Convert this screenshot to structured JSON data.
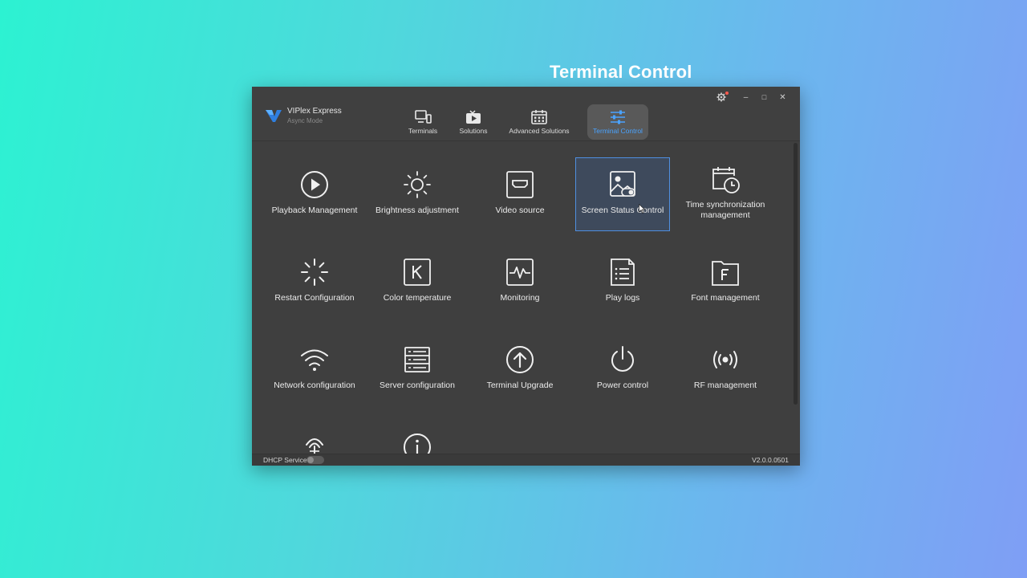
{
  "heading": "Terminal Control",
  "app": {
    "name": "VIPlex Express",
    "mode": "Async Mode"
  },
  "nav": [
    {
      "label": "Terminals",
      "icon": "terminals-icon"
    },
    {
      "label": "Solutions",
      "icon": "solutions-icon"
    },
    {
      "label": "Advanced Solutions",
      "icon": "calendar-icon"
    },
    {
      "label": "Terminal Control",
      "icon": "sliders-icon",
      "active": true
    }
  ],
  "window_controls": {
    "settings_icon": "gear-icon",
    "minimize": "–",
    "maximize": "□",
    "close": "✕"
  },
  "tiles": [
    {
      "label": "Playback Management",
      "icon": "play-circle-icon"
    },
    {
      "label": "Brightness adjustment",
      "icon": "sun-icon"
    },
    {
      "label": "Video source",
      "icon": "hdmi-icon"
    },
    {
      "label": "Screen Status Control",
      "icon": "screen-status-icon",
      "selected": true
    },
    {
      "label": "Time synchronization management",
      "icon": "calendar-clock-icon"
    },
    {
      "label": "Restart Configuration",
      "icon": "restart-spinner-icon"
    },
    {
      "label": "Color temperature",
      "icon": "k-box-icon"
    },
    {
      "label": "Monitoring",
      "icon": "pulse-monitor-icon"
    },
    {
      "label": "Play logs",
      "icon": "log-document-icon"
    },
    {
      "label": "Font management",
      "icon": "font-folder-icon"
    },
    {
      "label": "Network configuration",
      "icon": "wifi-icon"
    },
    {
      "label": "Server configuration",
      "icon": "server-icon"
    },
    {
      "label": "Terminal Upgrade",
      "icon": "upload-circle-icon"
    },
    {
      "label": "Power control",
      "icon": "power-icon"
    },
    {
      "label": "RF management",
      "icon": "rf-signal-icon"
    }
  ],
  "status": {
    "dhcp_label": "DHCP Service",
    "dhcp_on": false,
    "version": "V2.0.0.0501"
  },
  "colors": {
    "accent": "#4aa3ff",
    "window_bg": "#3f3f3f",
    "selected_border": "#4f8fe0"
  }
}
